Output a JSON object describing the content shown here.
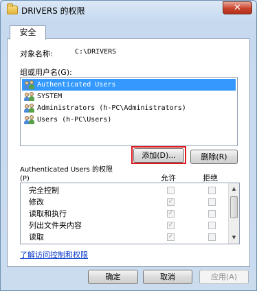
{
  "window": {
    "title": "DRIVERS 的权限",
    "close_glyph": "✕"
  },
  "tab": {
    "label": "安全"
  },
  "object": {
    "label": "对象名称:",
    "value": "C:\\DRIVERS"
  },
  "groups": {
    "label": "组或用户名(G):",
    "items": [
      {
        "name": "Authenticated Users",
        "selected": true
      },
      {
        "name": "SYSTEM",
        "selected": false
      },
      {
        "name": "Administrators (h-PC\\Administrators)",
        "selected": false
      },
      {
        "name": "Users (h-PC\\Users)",
        "selected": false
      }
    ]
  },
  "buttons": {
    "add": "添加(D)...",
    "remove": "删除(R)",
    "ok": "确定",
    "cancel": "取消",
    "apply": "应用(A)"
  },
  "permissions": {
    "label_line1": "Authenticated Users 的权限",
    "label_line2": "(P)",
    "col_allow": "允许",
    "col_deny": "拒绝",
    "rows": [
      {
        "name": "完全控制",
        "allow": false,
        "deny": false
      },
      {
        "name": "修改",
        "allow": true,
        "deny": false
      },
      {
        "name": "读取和执行",
        "allow": true,
        "deny": false
      },
      {
        "name": "列出文件夹内容",
        "allow": true,
        "deny": false
      },
      {
        "name": "读取",
        "allow": true,
        "deny": false
      }
    ]
  },
  "help_link": "了解访问控制和权限",
  "icons": {
    "title": "folder-icon",
    "user": "users-icon",
    "scroll_up": "▲",
    "scroll_down": "▼",
    "check": "✓"
  },
  "colors": {
    "selection": "#3399ff",
    "highlight_box": "#e0161d",
    "link": "#0033cc"
  }
}
